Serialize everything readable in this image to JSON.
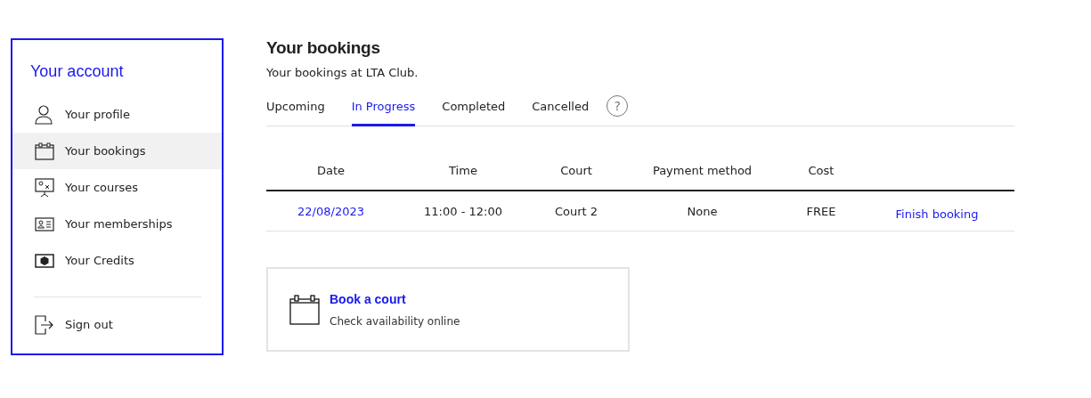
{
  "sidebar": {
    "title": "Your account",
    "items": [
      {
        "label": "Your profile",
        "selected": false
      },
      {
        "label": "Your bookings",
        "selected": true
      },
      {
        "label": "Your courses",
        "selected": false
      },
      {
        "label": "Your memberships",
        "selected": false
      },
      {
        "label": "Your Credits",
        "selected": false
      }
    ],
    "sign_out": "Sign out"
  },
  "page": {
    "title": "Your bookings",
    "subtitle": "Your bookings at LTA Club."
  },
  "tabs": [
    {
      "label": "Upcoming",
      "selected": false
    },
    {
      "label": "In Progress",
      "selected": true
    },
    {
      "label": "Completed",
      "selected": false
    },
    {
      "label": "Cancelled",
      "selected": false
    }
  ],
  "help": "?",
  "table": {
    "columns": [
      "Date",
      "Time",
      "Court",
      "Payment method",
      "Cost"
    ],
    "rows": [
      {
        "date": "22/08/2023",
        "time": "11:00 - 12:00",
        "court": "Court 2",
        "payment": "None",
        "cost": "FREE",
        "action": "Finish booking"
      }
    ]
  },
  "card": {
    "title": "Book a court",
    "text": "Check availability online"
  }
}
